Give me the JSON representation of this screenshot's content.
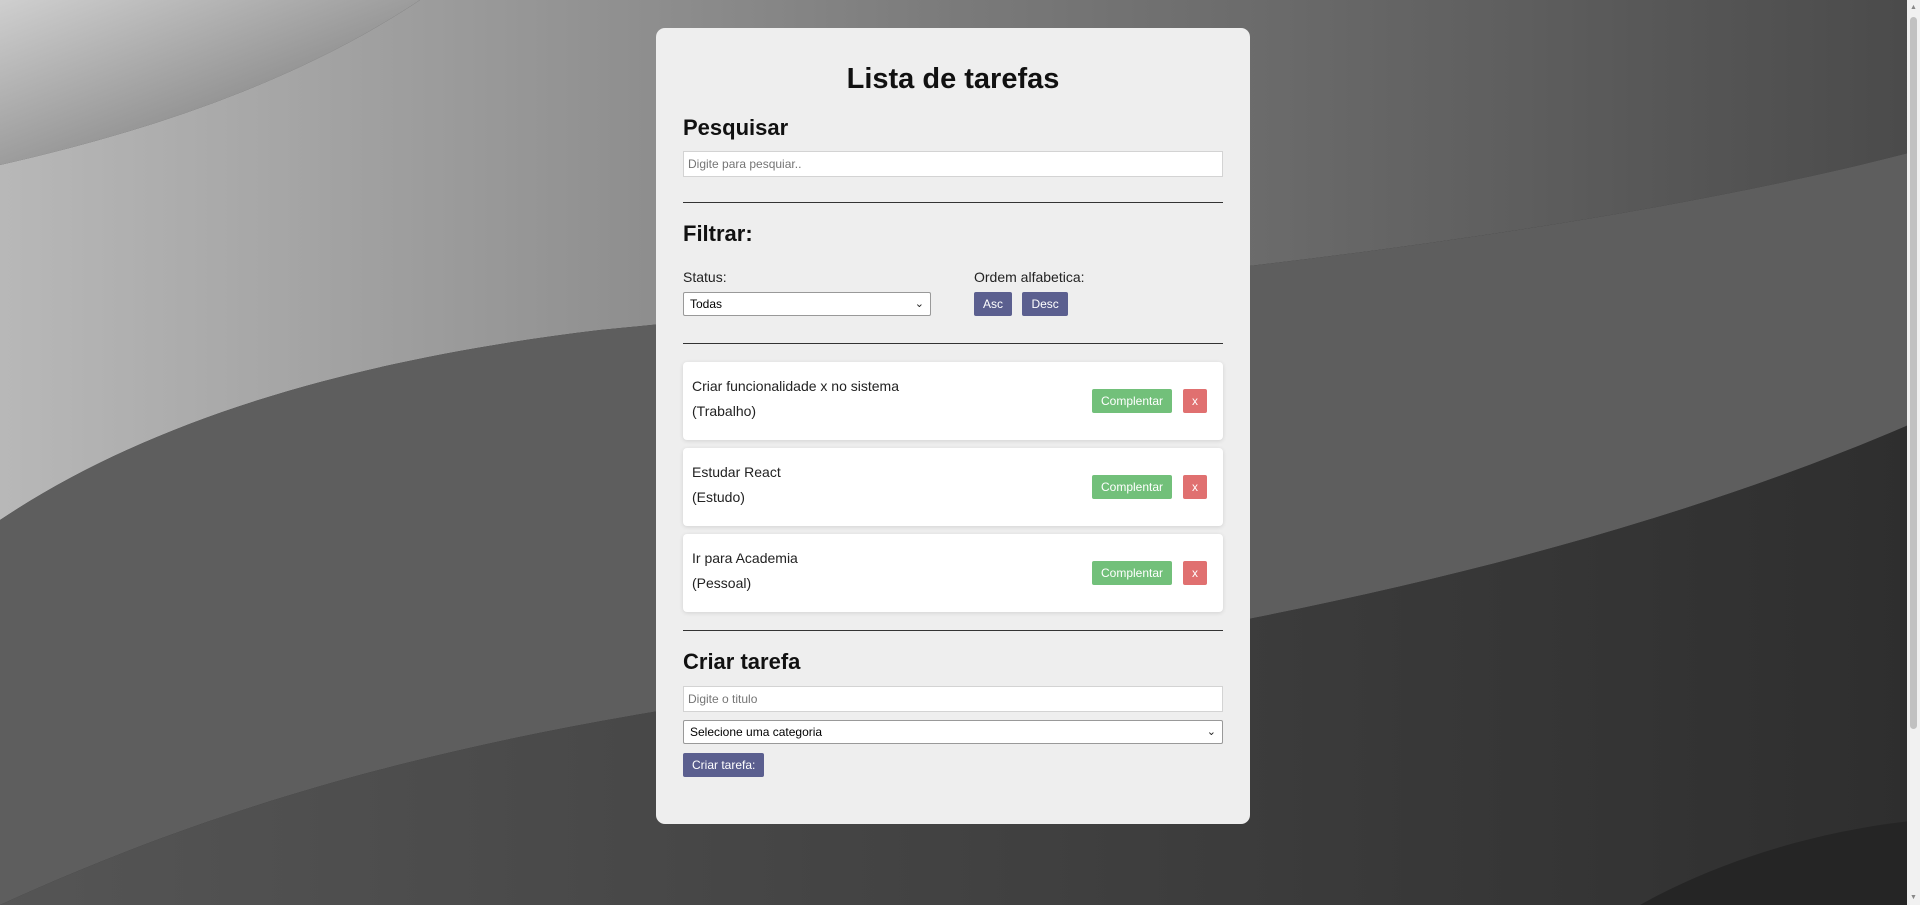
{
  "app": {
    "title": "Lista de tarefas"
  },
  "search": {
    "heading": "Pesquisar",
    "placeholder": "Digite para pesquiar..",
    "value": ""
  },
  "filter": {
    "heading": "Filtrar:",
    "status_label": "Status:",
    "status_value": "Todas",
    "order_label": "Ordem alfabetica:",
    "asc_label": "Asc",
    "desc_label": "Desc"
  },
  "todos": [
    {
      "title": "Criar funcionalidade x no sistema",
      "category": "(Trabalho)",
      "complete_label": "Complentar",
      "remove_label": "x"
    },
    {
      "title": "Estudar React",
      "category": "(Estudo)",
      "complete_label": "Complentar",
      "remove_label": "x"
    },
    {
      "title": "Ir para Academia",
      "category": "(Pessoal)",
      "complete_label": "Complentar",
      "remove_label": "x"
    }
  ],
  "create": {
    "heading": "Criar tarefa",
    "title_placeholder": "Digite o titulo",
    "title_value": "",
    "category_value": "Selecione uma categoria",
    "submit_label": "Criar tarefa:"
  },
  "colors": {
    "card_bg": "#eeeeee",
    "primary_button": "#5b5f8f",
    "complete_button": "#72c07a",
    "remove_button": "#e07070"
  },
  "icons": {
    "select_arrow": "chevron-down-icon",
    "scroll_up": "scroll-up-arrow-icon",
    "scroll_down": "scroll-down-arrow-icon"
  }
}
